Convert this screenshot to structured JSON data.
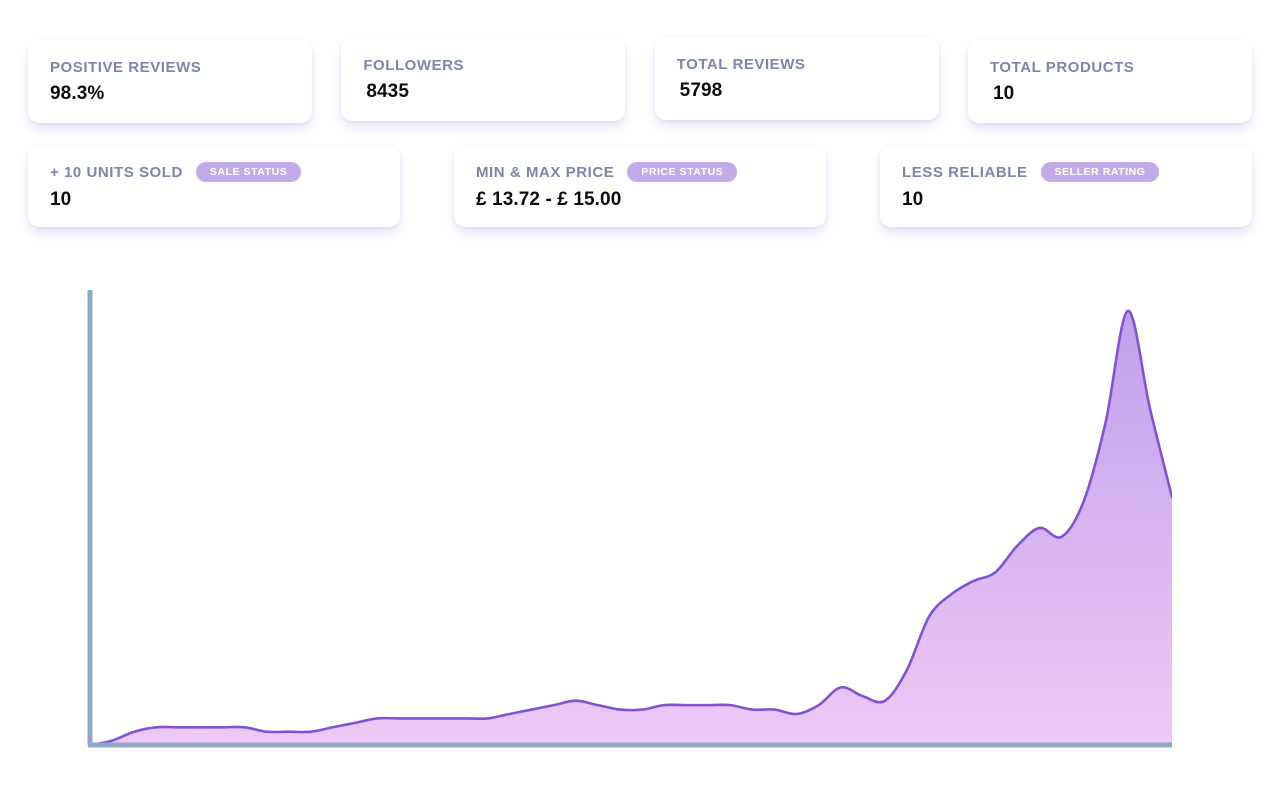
{
  "stats_row_1": [
    {
      "id": "positive-reviews",
      "label": "POSITIVE REVIEWS",
      "value": "98.3%"
    },
    {
      "id": "followers",
      "label": "FOLLOWERS",
      "value": "8435"
    },
    {
      "id": "total-reviews",
      "label": "TOTAL REVIEWS",
      "value": "5798"
    },
    {
      "id": "total-products",
      "label": "TOTAL PRODUCTS",
      "value": "10"
    }
  ],
  "stats_row_2": [
    {
      "id": "units-sold",
      "label": "+ 10 UNITS SOLD",
      "badge": "SALE STATUS",
      "value": "10"
    },
    {
      "id": "min-max-price",
      "label": "MIN & MAX PRICE",
      "badge": "PRICE STATUS",
      "value": "£ 13.72 - £ 15.00"
    },
    {
      "id": "less-reliable",
      "label": "LESS RELIABLE",
      "badge": "SELLER RATING",
      "value": "10"
    }
  ],
  "colors": {
    "label": "#7b86ab",
    "value": "#0c0c10",
    "badge_bg": "#c2abe8",
    "badge_text": "#ffffff",
    "axis": "#90a8c6",
    "area_stroke": "#7f54d4",
    "area_fill_top": "#c2a0ea",
    "area_fill_bottom": "#edc9f7",
    "card_bg": "#ffffff",
    "page_bg": "#ffffff"
  },
  "chart_data": {
    "type": "area",
    "title": "",
    "xlabel": "",
    "ylabel": "",
    "grid": false,
    "legend": null,
    "axis_color": "#90a8c6",
    "line_color": "#7f54d4",
    "fill_gradient": [
      "#c2a0ea",
      "#edc9f7"
    ],
    "xlim": [
      0,
      52
    ],
    "ylim": [
      0,
      100
    ],
    "x": [
      0,
      1,
      2,
      3,
      4,
      5,
      6,
      7,
      8,
      9,
      10,
      11,
      12,
      13,
      14,
      15,
      16,
      17,
      18,
      19,
      20,
      21,
      22,
      23,
      24,
      25,
      26,
      27,
      28,
      29,
      30,
      31,
      32,
      33,
      34,
      35,
      36,
      37,
      38,
      39,
      40,
      41,
      42,
      43,
      44,
      45,
      46,
      47,
      48,
      49
    ],
    "values": [
      0,
      1,
      3,
      4,
      4,
      4,
      4,
      4,
      3,
      3,
      3,
      4,
      5,
      6,
      6,
      6,
      6,
      6,
      6,
      7,
      8,
      9,
      10,
      9,
      8,
      8,
      9,
      9,
      9,
      9,
      8,
      8,
      7,
      9,
      13,
      11,
      10,
      17,
      29,
      34,
      37,
      39,
      45,
      49,
      47,
      55,
      73,
      98,
      76,
      56
    ]
  }
}
